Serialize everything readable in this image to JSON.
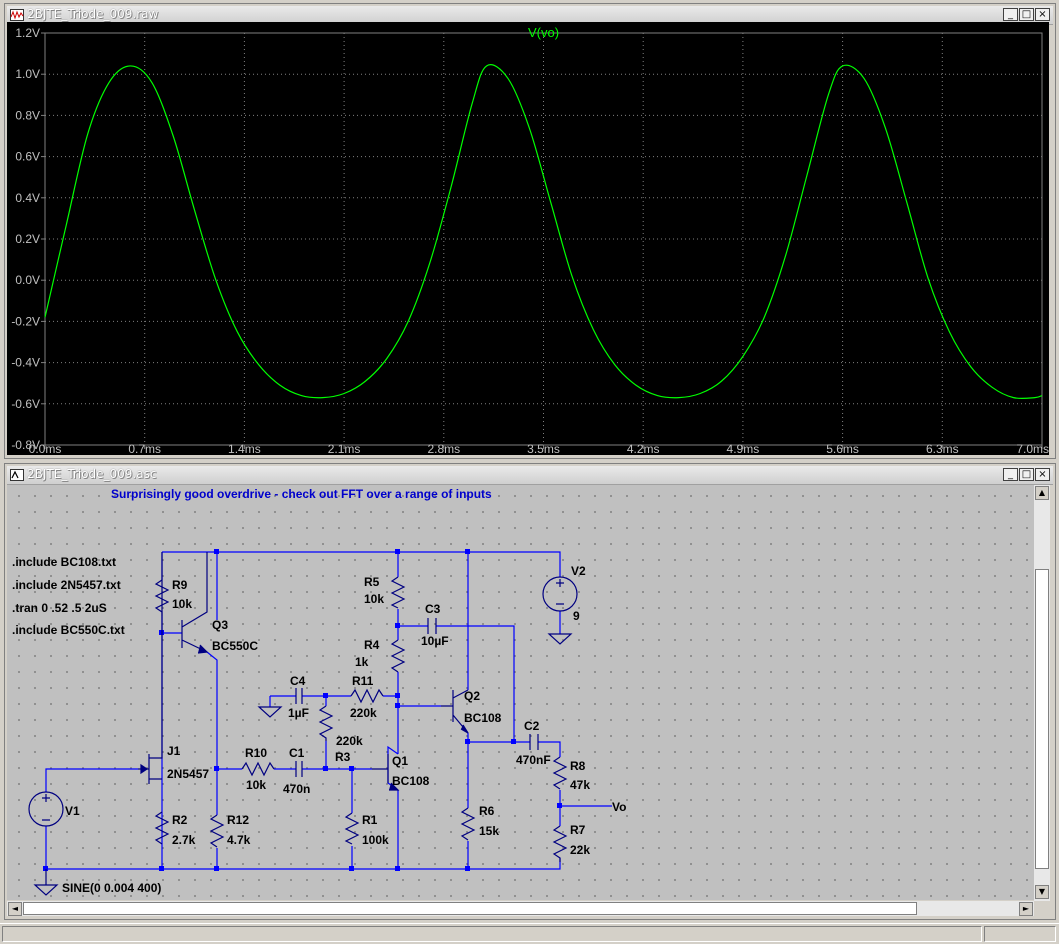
{
  "waveform_window": {
    "title": "2BJTE_Triode_009.raw",
    "buttons": {
      "minimize": "_",
      "maximize": "□",
      "close": "×"
    }
  },
  "chart_data": {
    "type": "line",
    "title": "V(vo)",
    "x_ticks": [
      "0.0ms",
      "0.7ms",
      "1.4ms",
      "2.1ms",
      "2.8ms",
      "3.5ms",
      "4.2ms",
      "4.9ms",
      "5.6ms",
      "6.3ms",
      "7.0ms"
    ],
    "y_ticks": [
      "1.2V",
      "1.0V",
      "0.8V",
      "0.6V",
      "0.4V",
      "0.2V",
      "0.0V",
      "-0.2V",
      "-0.4V",
      "-0.6V",
      "-0.8V"
    ],
    "xlim": [
      0,
      7.0
    ],
    "ylim": [
      -0.8,
      1.2
    ],
    "grid": true,
    "line_color": "#00ff00",
    "background": "#000000",
    "series": [
      {
        "x": [
          0,
          0.15,
          0.3,
          0.45,
          0.6,
          0.75,
          0.9,
          1.05,
          1.2,
          1.35,
          1.5,
          1.65,
          1.8,
          1.95,
          2.1,
          2.25,
          2.4,
          2.55,
          2.7,
          2.85,
          3.0,
          3.1,
          3.25,
          3.4,
          3.55,
          3.7,
          3.85,
          4.0,
          4.15,
          4.3,
          4.45,
          4.6,
          4.75,
          4.9,
          5.05,
          5.2,
          5.35,
          5.5,
          5.6,
          5.75,
          5.9,
          6.05,
          6.2,
          6.35,
          6.5,
          6.65,
          6.8,
          6.95,
          7.0
        ],
        "y": [
          -0.18,
          0.27,
          0.71,
          0.96,
          1.04,
          0.96,
          0.7,
          0.34,
          0.0,
          -0.25,
          -0.41,
          -0.51,
          -0.56,
          -0.57,
          -0.55,
          -0.49,
          -0.38,
          -0.2,
          0.08,
          0.45,
          0.86,
          1.04,
          0.98,
          0.74,
          0.38,
          0.02,
          -0.24,
          -0.41,
          -0.51,
          -0.56,
          -0.57,
          -0.55,
          -0.49,
          -0.37,
          -0.18,
          0.12,
          0.51,
          0.9,
          1.04,
          0.98,
          0.74,
          0.38,
          0.01,
          -0.25,
          -0.42,
          -0.52,
          -0.57,
          -0.57,
          -0.56
        ]
      }
    ]
  },
  "schematic_window": {
    "title": "2BJTE_Triode_009.asc",
    "buttons": {
      "minimize": "_",
      "maximize": "□",
      "close": "×"
    },
    "comment": "Surprisingly good overdrive - check out FFT over a range of inputs",
    "directives": [
      ".include BC108.txt",
      ".include 2N5457.txt",
      ".tran 0 .52 .5 2uS",
      ".include BC550C.txt"
    ],
    "components": {
      "R9": {
        "ref": "R9",
        "value": "10k"
      },
      "Q3": {
        "ref": "Q3",
        "value": "BC550C"
      },
      "R5": {
        "ref": "R5",
        "value": "10k"
      },
      "C3": {
        "ref": "C3",
        "value": "10µF"
      },
      "V2": {
        "ref": "V2",
        "value": "9"
      },
      "R4": {
        "ref": "R4",
        "value": "1k"
      },
      "C4": {
        "ref": "C4",
        "value": "1µF"
      },
      "R11": {
        "ref": "R11",
        "value": "220k"
      },
      "Q2": {
        "ref": "Q2",
        "value": "BC108"
      },
      "R3": {
        "ref": "R3",
        "value": "220k"
      },
      "C2": {
        "ref": "C2",
        "value": "470nF"
      },
      "J1": {
        "ref": "J1",
        "value": "2N5457"
      },
      "R10": {
        "ref": "R10",
        "value": "10k"
      },
      "C1": {
        "ref": "C1",
        "value": "470n"
      },
      "Q1": {
        "ref": "Q1",
        "value": "BC108"
      },
      "R8": {
        "ref": "R8",
        "value": "47k"
      },
      "V1": {
        "ref": "V1",
        "value": "SINE(0 0.004 400)"
      },
      "R2": {
        "ref": "R2",
        "value": "2.7k"
      },
      "R12": {
        "ref": "R12",
        "value": "4.7k"
      },
      "R1": {
        "ref": "R1",
        "value": "100k"
      },
      "R6": {
        "ref": "R6",
        "value": "15k"
      },
      "R7": {
        "ref": "R7",
        "value": "22k"
      }
    },
    "net_labels": {
      "vo": "Vo"
    }
  },
  "scrollbar": {
    "left_arrow": "◄",
    "right_arrow": "►",
    "up_arrow": "▲",
    "down_arrow": "▼"
  },
  "colors": {
    "wire": "#0000ff",
    "component": "#000080",
    "label_text": "#000000",
    "comment_text": "#0000cc",
    "trace": "#00ff00"
  }
}
